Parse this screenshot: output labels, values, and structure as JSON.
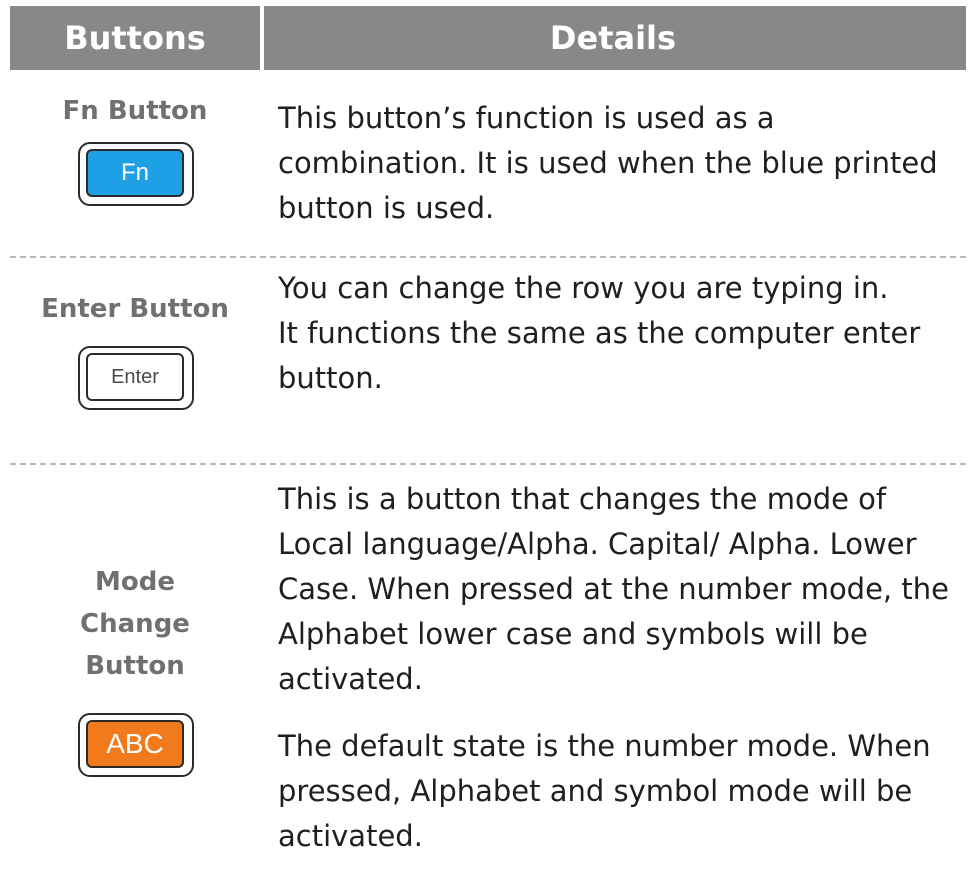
{
  "header": {
    "buttons_label": "Buttons",
    "details_label": "Details",
    "background_color": "#888888"
  },
  "rows": [
    {
      "name_lines": [
        "Fn  Button"
      ],
      "key_label": "Fn",
      "key_color": "#1ea0e6",
      "details": [
        "This button’s function is used as a combination. It is used when the blue printed button is used."
      ]
    },
    {
      "name_lines": [
        "Enter Button"
      ],
      "key_label": "Enter",
      "key_color": "#ffffff",
      "details": [
        "You can change the row you are typing in.",
        "It functions the same as the computer enter button."
      ]
    },
    {
      "name_lines": [
        "Mode",
        "Change",
        "Button"
      ],
      "key_label": "ABC",
      "key_color": "#f07a1c",
      "details": [
        "This is a button that changes the mode of Local language/Alpha. Capital/ Alpha. Lower Case. When pressed at the number mode, the Alphabet lower case and symbols will be activated.",
        "The default state is the number mode. When pressed, Alphabet and symbol mode will be activated."
      ]
    }
  ]
}
